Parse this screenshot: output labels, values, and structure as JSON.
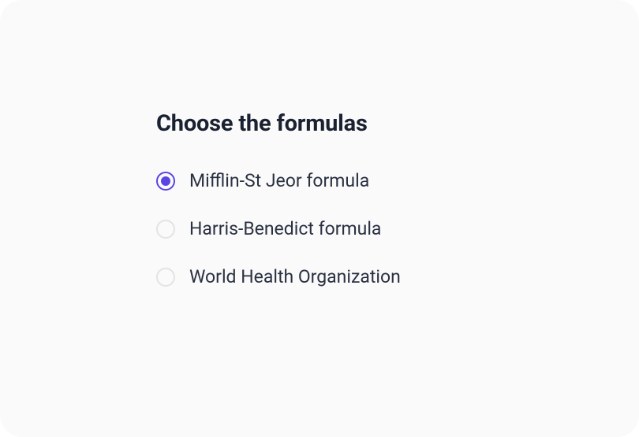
{
  "title": "Choose the formulas",
  "options": [
    {
      "label": "Mifflin-St Jeor formula",
      "selected": true
    },
    {
      "label": "Harris-Benedict formula",
      "selected": false
    },
    {
      "label": "World Health Organization",
      "selected": false
    }
  ],
  "colors": {
    "accent": "#5a44e3",
    "text_primary": "#1a2130",
    "text_secondary": "#2a3142",
    "border_inactive": "#e3e3e5",
    "background": "#fafafa"
  }
}
